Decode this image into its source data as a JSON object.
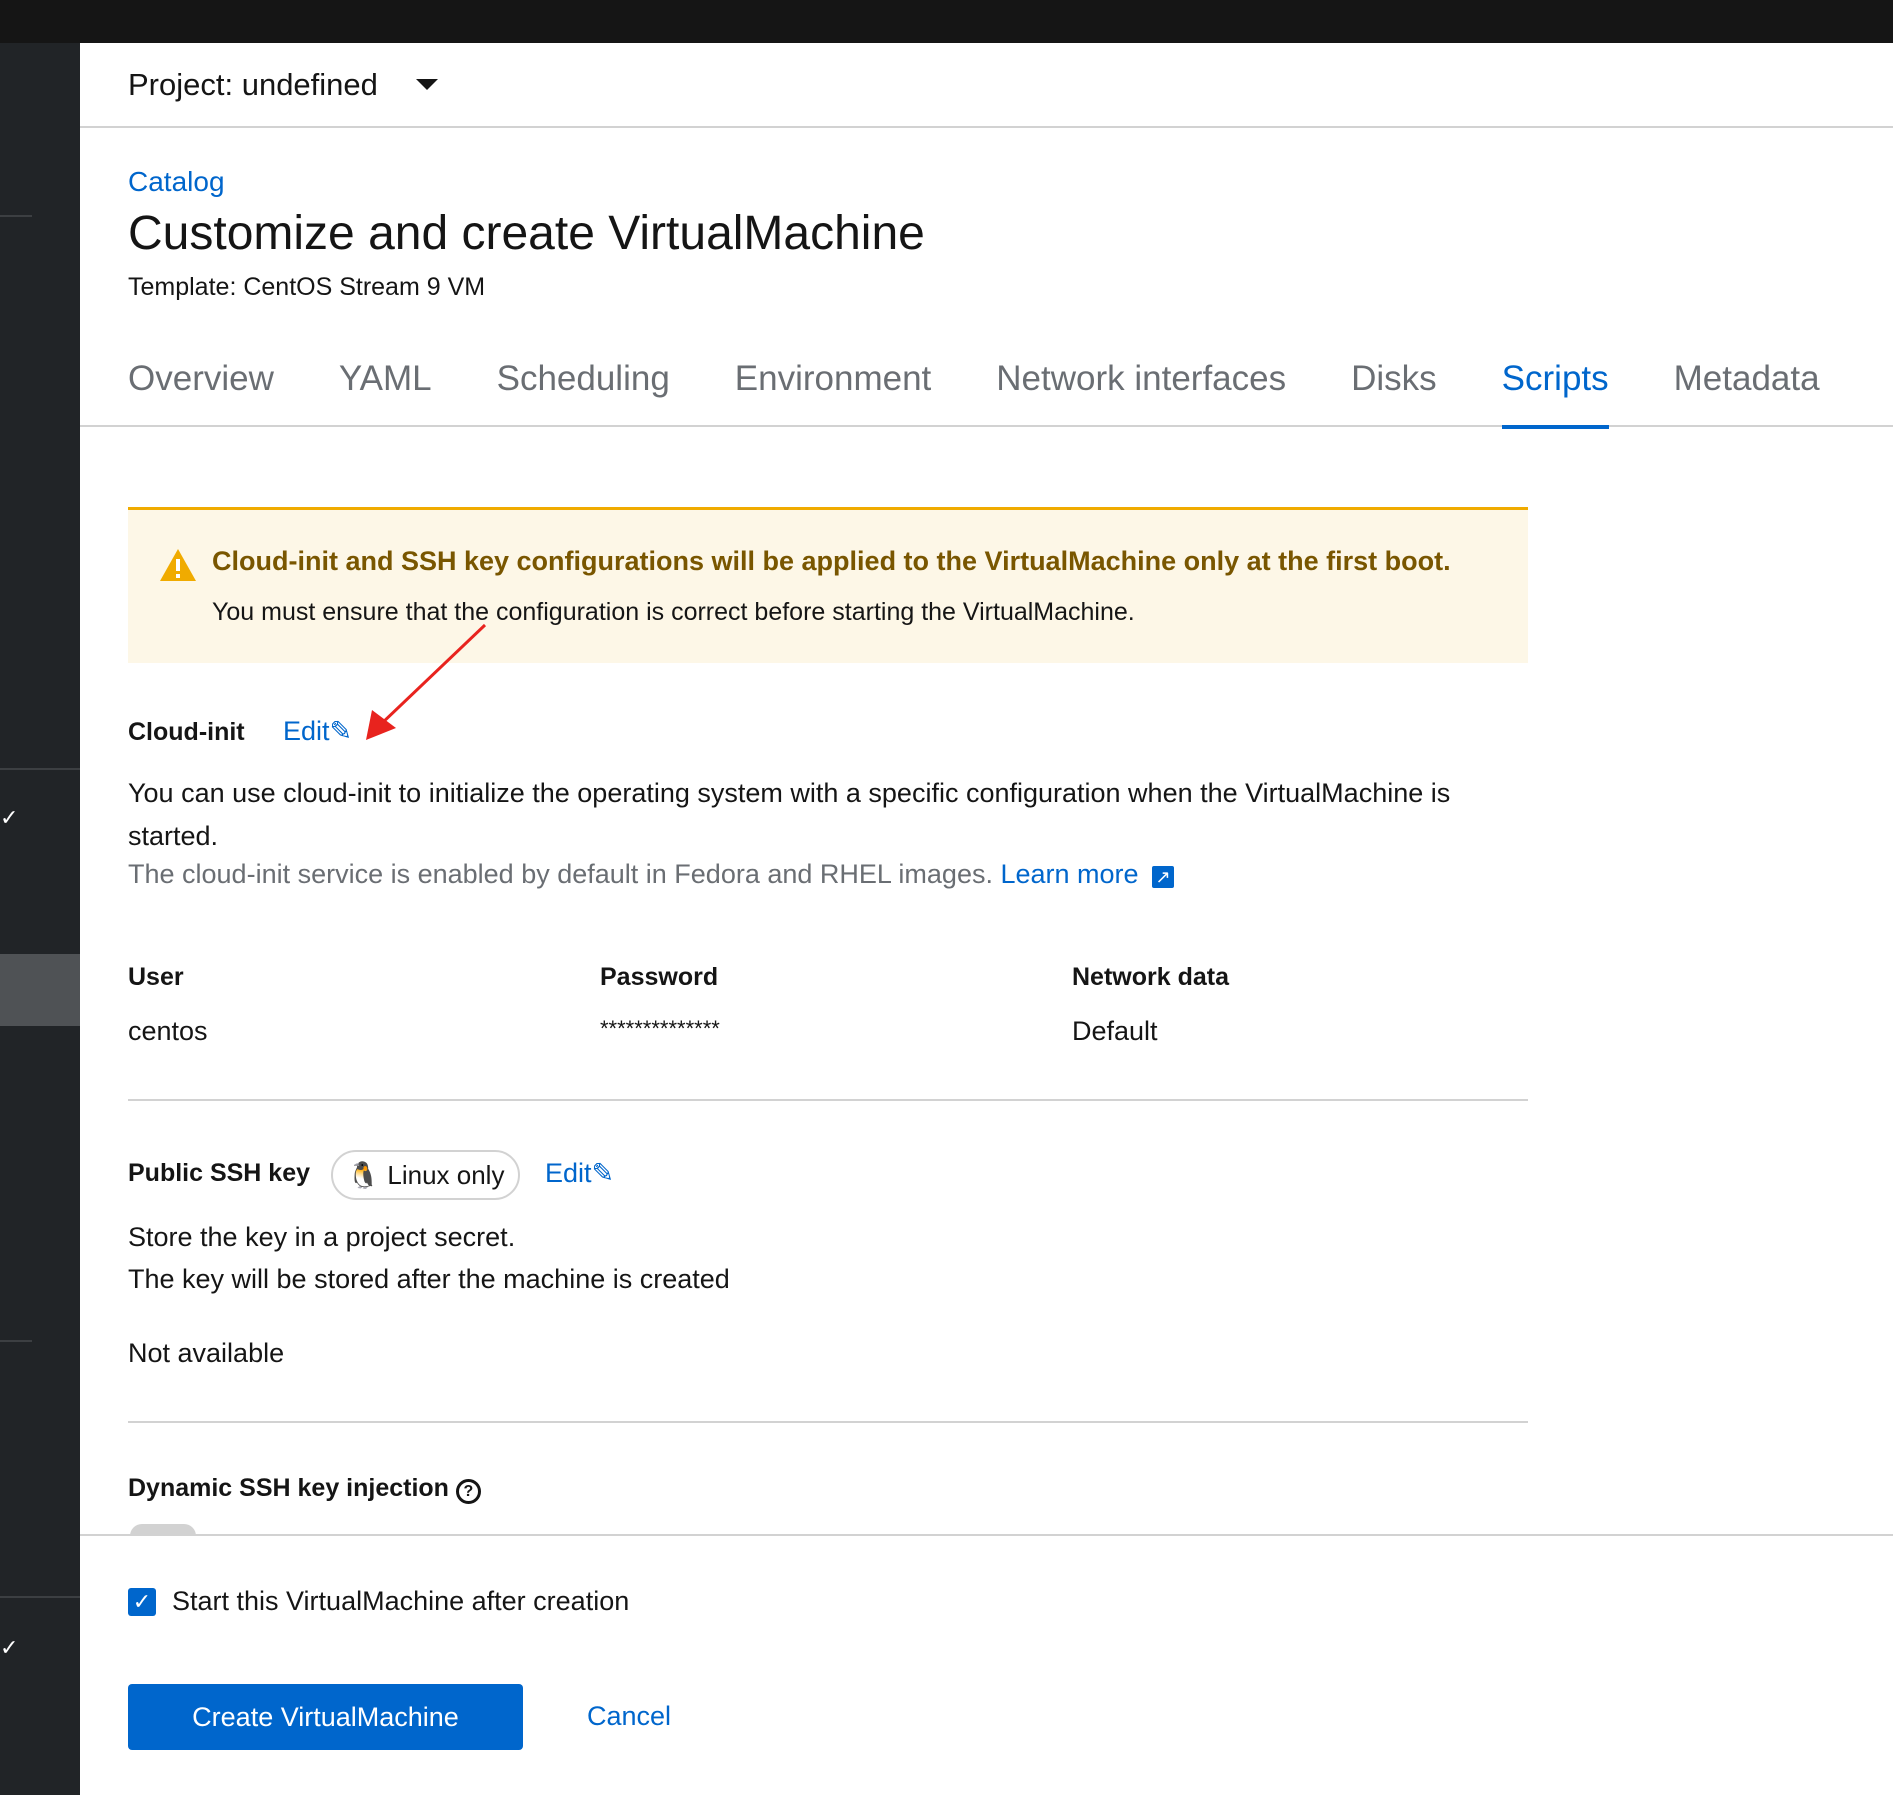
{
  "header": {
    "project_label": "Project: undefined"
  },
  "breadcrumb": {
    "catalog": "Catalog"
  },
  "page": {
    "title": "Customize and create VirtualMachine",
    "subtitle": "Template: CentOS Stream 9 VM"
  },
  "tabs": [
    {
      "label": "Overview"
    },
    {
      "label": "YAML"
    },
    {
      "label": "Scheduling"
    },
    {
      "label": "Environment"
    },
    {
      "label": "Network interfaces"
    },
    {
      "label": "Disks"
    },
    {
      "label": "Scripts",
      "active": true
    },
    {
      "label": "Metadata"
    }
  ],
  "alert": {
    "title": "Cloud-init and SSH key configurations will be applied to the VirtualMachine only at the first boot.",
    "body": "You must ensure that the configuration is correct before starting the VirtualMachine."
  },
  "cloud_init": {
    "label": "Cloud-init",
    "edit": "Edit",
    "desc": "You can use cloud-init to initialize the operating system with a specific configuration when the VirtualMachine is started.",
    "helper": "The cloud-init service is enabled by default in Fedora and RHEL images.",
    "learn_more": "Learn more",
    "fields": [
      {
        "label": "User",
        "value": "centos"
      },
      {
        "label": "Password",
        "value": "**************"
      },
      {
        "label": "Network data",
        "value": "Default"
      }
    ]
  },
  "ssh": {
    "label": "Public SSH key",
    "badge": "Linux only",
    "edit": "Edit",
    "line1": "Store the key in a project secret.",
    "line2": "The key will be stored after the machine is created",
    "value": "Not available"
  },
  "dynamic": {
    "label": "Dynamic SSH key injection"
  },
  "footer": {
    "start_after": "Start this VirtualMachine after creation",
    "start_checked": true,
    "create": "Create VirtualMachine",
    "cancel": "Cancel"
  },
  "colors": {
    "primary": "#0066cc",
    "warning": "#f0ab00",
    "annotation": "#e8231e"
  }
}
